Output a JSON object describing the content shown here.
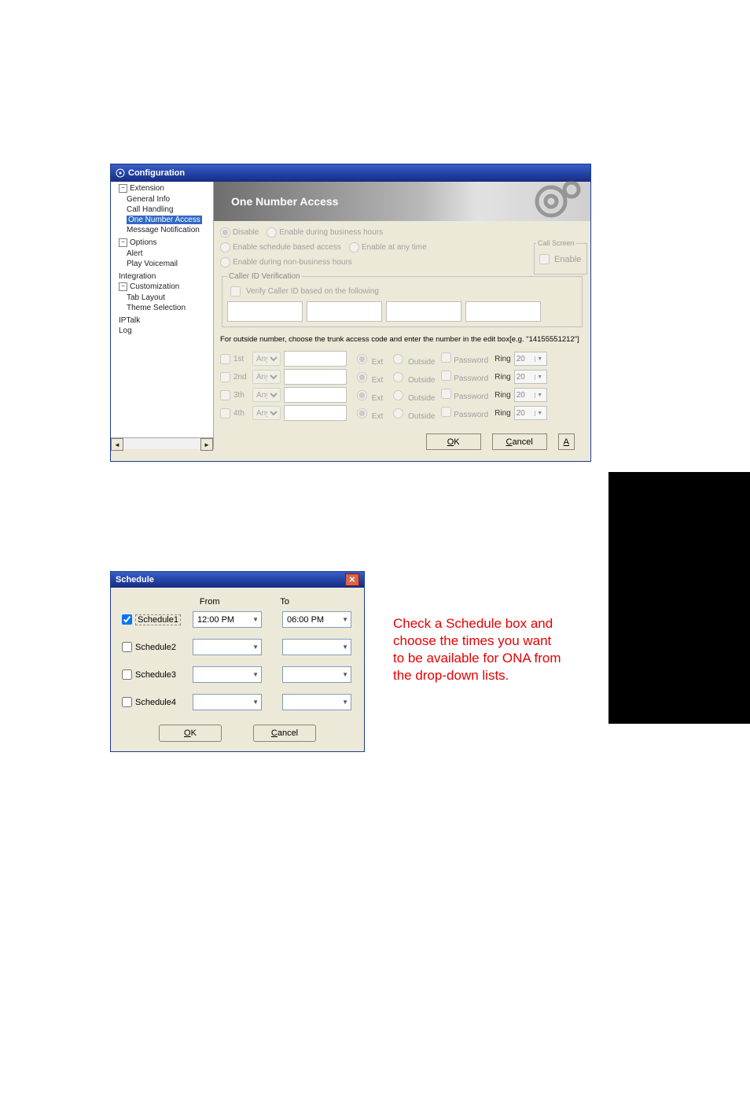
{
  "config_window": {
    "title": "Configuration",
    "tree": {
      "extension": "Extension",
      "general_info": "General Info",
      "call_handling": "Call Handling",
      "one_number_access": "One Number Access",
      "message_notification": "Message Notification",
      "options": "Options",
      "alert": "Alert",
      "play_voicemail": "Play Voicemail",
      "integration": "Integration",
      "customization": "Customization",
      "tab_layout": "Tab Layout",
      "theme_selection": "Theme Selection",
      "iptalk": "IPTalk",
      "log": "Log"
    },
    "banner": "One Number Access",
    "radios": {
      "disable": "Disable",
      "enable_bh": "Enable during business hours",
      "enable_sched": "Enable schedule based access",
      "enable_any": "Enable at any time",
      "enable_nbh": "Enable during non-business hours"
    },
    "call_screen": {
      "legend": "Call Screen",
      "enable": "Enable"
    },
    "caller_id": {
      "legend": "Caller ID Verification",
      "verify": "Verify Caller ID based on the following"
    },
    "outside_note": "For outside number, choose the trunk access code and enter the number in the edit box[e.g. \"14155551212\"]",
    "rows": [
      {
        "ord": "1st",
        "any": "Any",
        "ext": "Ext",
        "outside": "Outside",
        "pwd": "Password",
        "ring": "Ring",
        "ringval": "20"
      },
      {
        "ord": "2nd",
        "any": "Any",
        "ext": "Ext",
        "outside": "Outside",
        "pwd": "Password",
        "ring": "Ring",
        "ringval": "20"
      },
      {
        "ord": "3th",
        "any": "Any",
        "ext": "Ext",
        "outside": "Outside",
        "pwd": "Password",
        "ring": "Ring",
        "ringval": "20"
      },
      {
        "ord": "4th",
        "any": "Any",
        "ext": "Ext",
        "outside": "Outside",
        "pwd": "Password",
        "ring": "Ring",
        "ringval": "20"
      }
    ],
    "buttons": {
      "ok": "OK",
      "cancel": "Cancel",
      "apply": "A"
    }
  },
  "schedule_window": {
    "title": "Schedule",
    "from": "From",
    "to": "To",
    "rows": [
      {
        "label": "Schedule1",
        "checked": true,
        "from": "12:00 PM",
        "to": "06:00 PM"
      },
      {
        "label": "Schedule2",
        "checked": false,
        "from": "",
        "to": ""
      },
      {
        "label": "Schedule3",
        "checked": false,
        "from": "",
        "to": ""
      },
      {
        "label": "Schedule4",
        "checked": false,
        "from": "",
        "to": ""
      }
    ],
    "ok": "OK",
    "cancel": "Cancel"
  },
  "annotation": "Check a Schedule box and choose the times you want to be available for ONA from the drop-down lists."
}
